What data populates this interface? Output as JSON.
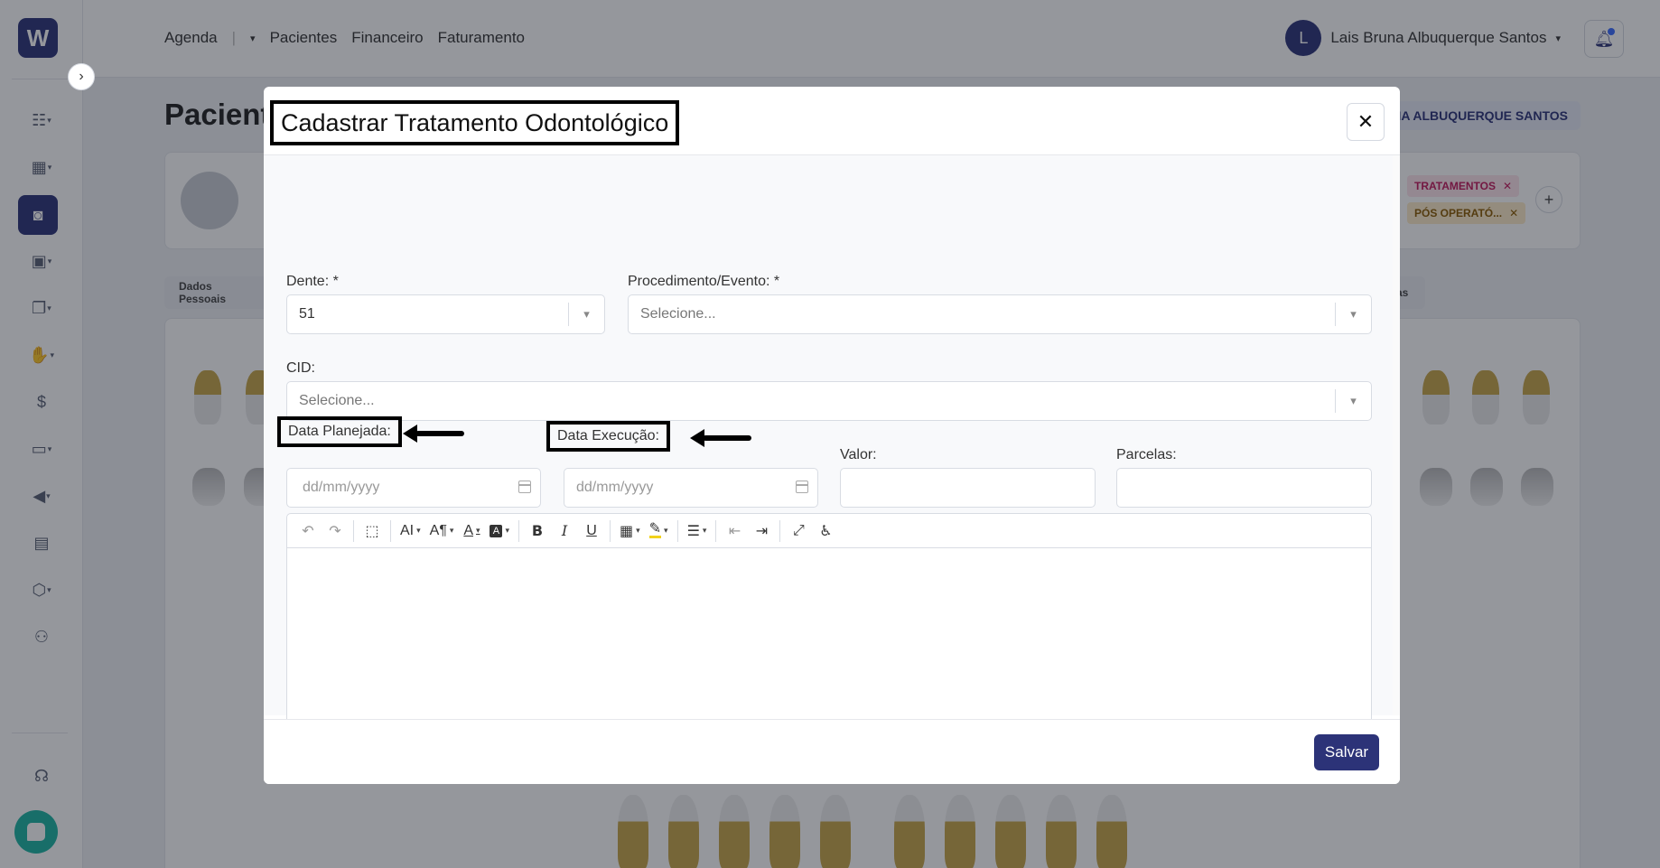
{
  "app": {
    "logo_letter": "W",
    "nav": [
      "Agenda",
      "Pacientes",
      "Financeiro",
      "Faturamento"
    ],
    "user": {
      "initial": "L",
      "name": "Lais Bruna Albuquerque Santos"
    },
    "page_title": "Pacient",
    "patient_pill": "NA ALBUQUERQUE SANTOS",
    "tags": [
      "TRATAMENTOS",
      "PÓS OPERATÓ..."
    ],
    "tab_left": "Dados Pessoais",
    "tab_right": "as"
  },
  "modal": {
    "title": "Cadastrar Tratamento Odontológico",
    "dente": {
      "label": "Dente: *",
      "value": "51"
    },
    "procedimento": {
      "label": "Procedimento/Evento: *",
      "placeholder": "Selecione..."
    },
    "cid": {
      "label": "CID:",
      "placeholder": "Selecione..."
    },
    "data_planejada": {
      "label": "Data Planejada:",
      "placeholder": "dd/mm/yyyy"
    },
    "data_execucao": {
      "label": "Data Execução:",
      "placeholder": "dd/mm/yyyy"
    },
    "valor": {
      "label": "Valor:",
      "value": ""
    },
    "parcelas": {
      "label": "Parcelas:",
      "value": ""
    },
    "editor_toolbar": {
      "undo": "↶",
      "redo": "↷",
      "font_size": "AI",
      "paragraph": "A¶",
      "font_color": "A",
      "bg_color": "A",
      "bold": "B",
      "italic": "I",
      "underline": "U"
    },
    "save_label": "Salvar"
  },
  "colors": {
    "brand": "#2c3378",
    "chat": "#1cb5a3",
    "annotation": "#000000"
  }
}
